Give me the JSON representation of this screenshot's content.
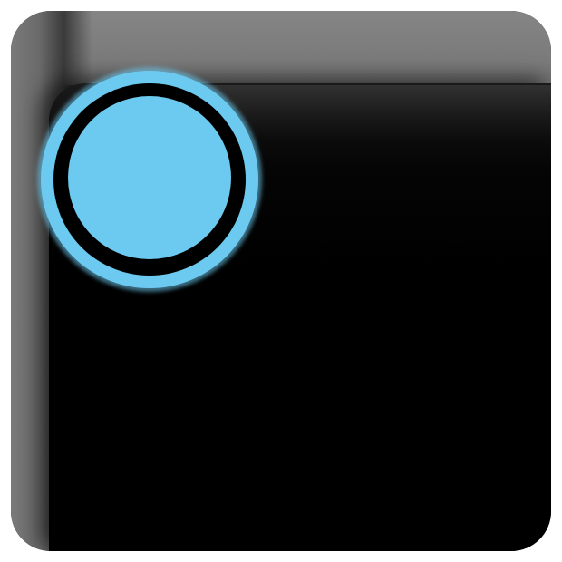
{
  "icon": {
    "kind": "rounded-square-app-icon",
    "colors": {
      "face": "#000000",
      "bevel": "#7a7a7a",
      "accent": "#6ccaf0",
      "ring_outline": "#000000"
    },
    "indicator": {
      "icon": "circle-indicator-icon",
      "style": "filled circle inside outlined ring"
    }
  }
}
